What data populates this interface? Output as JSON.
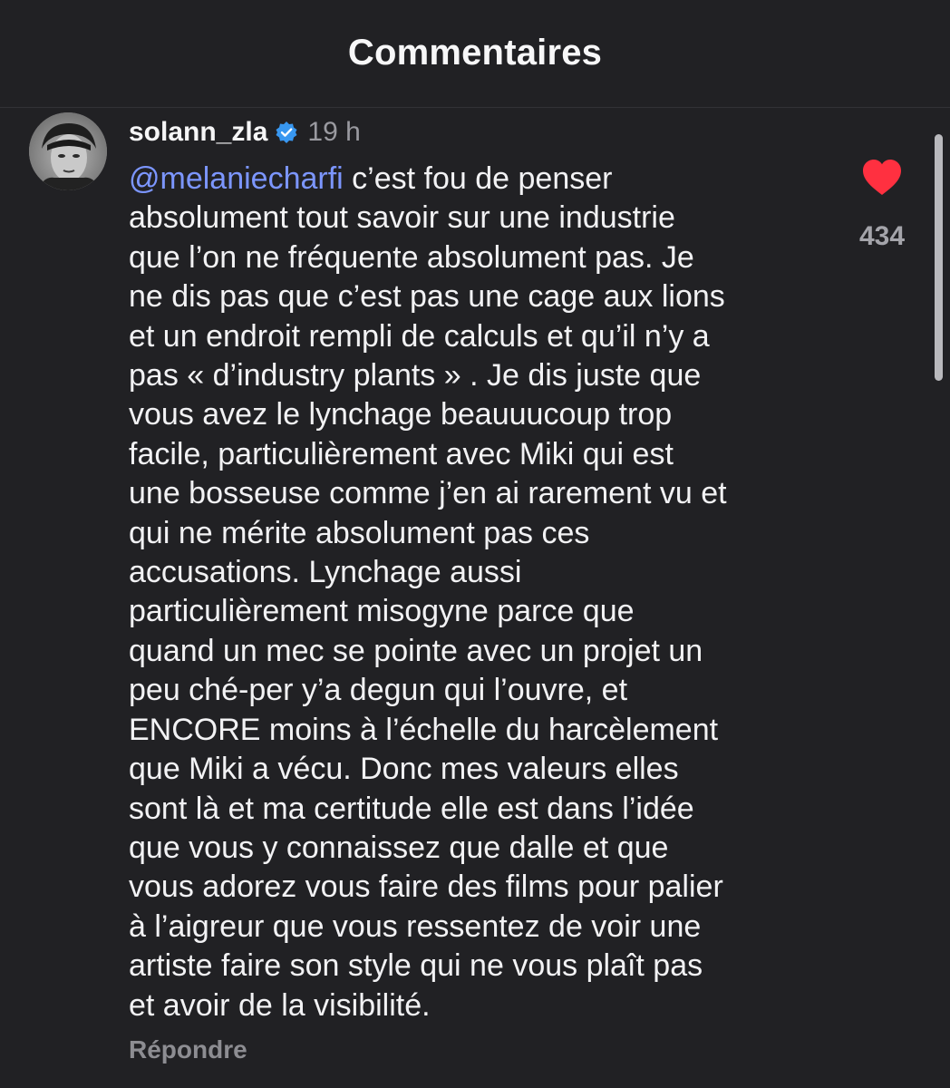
{
  "header": {
    "title": "Commentaires"
  },
  "comment": {
    "author": "solann_zla",
    "verified_icon": "verified-badge-icon",
    "time": "19 h",
    "mention": "@melaniecharfi",
    "lines": [
      " c’est fou de penser",
      "absolument tout savoir sur une industrie",
      "que l’on ne fréquente absolument pas. Je",
      "ne dis pas que c’est pas une cage aux lions",
      "et un endroit rempli de calculs et qu’il n’y a",
      "pas « d’industry plants » . Je dis juste que",
      "vous avez le lynchage beauuucoup trop",
      "facile, particulièrement avec Miki qui est",
      "une bosseuse comme j’en ai rarement vu et",
      "qui ne mérite absolument pas ces",
      "accusations. Lynchage aussi",
      "particulièrement misogyne parce que",
      "quand un mec se pointe avec un projet un",
      "peu ché-per y’a degun qui l’ouvre, et",
      "ENCORE moins à l’échelle du harcèlement",
      "que Miki a vécu. Donc mes valeurs elles",
      "sont là et ma certitude elle est dans l’idée",
      "que vous y connaissez que dalle et que",
      "vous adorez vous faire des films pour palier",
      "à l’aigreur que vous ressentez de voir une",
      "artiste faire son style qui ne vous plaît pas",
      "et avoir de la visibilité."
    ],
    "reply_label": "Répondre",
    "like_icon": "heart-icon",
    "like_count": "434",
    "like_color": "#ff3040",
    "mention_color": "#7c96ff"
  }
}
